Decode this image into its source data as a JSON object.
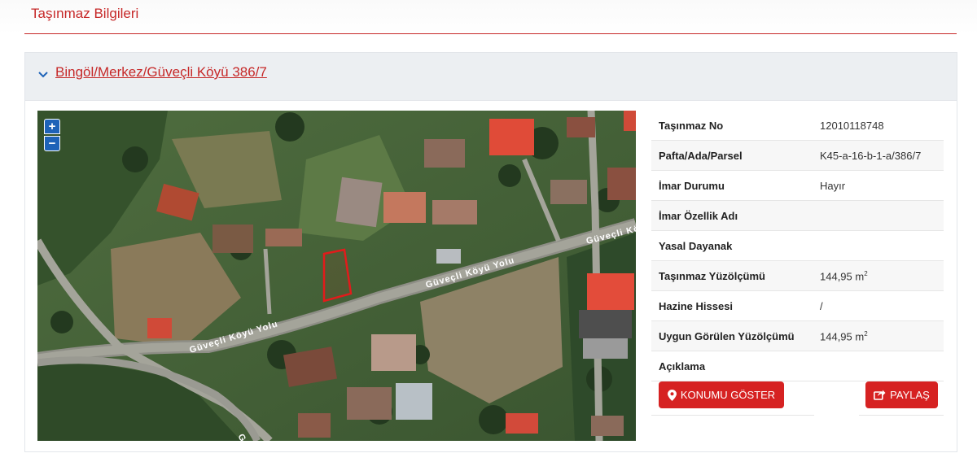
{
  "page": {
    "title": "Taşınmaz Bilgileri"
  },
  "panel": {
    "title": "Bingöl/Merkez/Güveçli Köyü 386/7"
  },
  "map": {
    "zoom_in": "+",
    "zoom_out": "−",
    "road_labels": [
      "Güveçli Köyü Yolu",
      "Güveçli Köyü Yolu",
      "Güveçli Köyü Yolu",
      "G"
    ]
  },
  "info": {
    "rows": [
      {
        "label": "Taşınmaz No",
        "value": "12010118748"
      },
      {
        "label": "Pafta/Ada/Parsel",
        "value": "K45-a-16-b-1-a/386/7"
      },
      {
        "label": "İmar Durumu",
        "value": "Hayır"
      },
      {
        "label": "İmar Özellik Adı",
        "value": ""
      },
      {
        "label": "Yasal Dayanak",
        "value": ""
      },
      {
        "label": "Taşınmaz Yüzölçümü",
        "value": "144,95 m",
        "unit_sup": "2"
      },
      {
        "label": "Hazine Hissesi",
        "value": "/"
      },
      {
        "label": "Uygun Görülen Yüzölçümü",
        "value": "144,95 m",
        "unit_sup": "2"
      },
      {
        "label": "Açıklama",
        "value": ""
      }
    ]
  },
  "actions": {
    "location_label": "KONUMU GÖSTER",
    "share_label": "PAYLAŞ"
  },
  "colors": {
    "accent": "#c62828",
    "button": "#d62222",
    "zoom": "#1e63b8",
    "parcel_outline": "#e21b1b"
  }
}
